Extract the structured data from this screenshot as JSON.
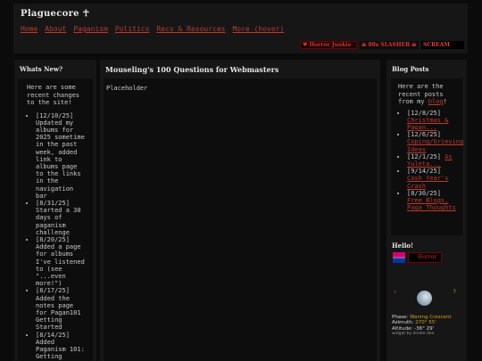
{
  "header": {
    "site_title": "Plaguecore ☥",
    "nav": [
      "Home",
      "About",
      "Paganism",
      "Politics",
      "Recs & Resources",
      "More (hover)"
    ],
    "badges": [
      "♥ Horror Junkie",
      "☠ 80s SLASHER ☠",
      "SCREAM"
    ]
  },
  "left": {
    "title": "Whats New?",
    "intro": "Here are some recent changes to the site!",
    "updates": [
      "[12/10/25] Updated my albums for 2025 sometime in the past week, added link to albums page to the links in the navigation bar",
      "[8/31/25] Started a 30 days of paganism challenge",
      "[8/20/25] Added a page for albums I've listened to (see \"...even more!\")",
      "[8/17/25] Added the notes page for Pagan101 Getting Started",
      "[8/14/25] Added Paganism 101: Getting"
    ]
  },
  "main": {
    "title": "Mouseling's 100 Questions for Webmasters",
    "content": "Placeholder"
  },
  "right": {
    "blog_title": "Blog Posts",
    "blog_intro_before": "Here are the recent posts from my ",
    "blog_link": "blog",
    "blog_intro_after": "!",
    "posts": [
      {
        "date": "[12/8/25]",
        "title": "Christmas & Pagan..."
      },
      {
        "date": "[12/6/25]",
        "title": "Coping/Grieving Ideas"
      },
      {
        "date": "[12/1/25]",
        "title": "As Yuleta..."
      },
      {
        "date": "[9/14/25]",
        "title": "Cash Year's Crash"
      },
      {
        "date": "[8/30/25]",
        "title": "Free Blogs, Paga Thoughts"
      }
    ],
    "hello_title": "Hello!",
    "horror_badge": "Horror",
    "moon": {
      "nav_prev": "‹",
      "nav_next": "?",
      "phase_label": "Phase:",
      "phase": "Waning Crescent",
      "azimuth_label": "Azimuth:",
      "azimuth": "270° 55'",
      "altitude_label": "Altitude:",
      "altitude": "-36° 29'",
      "credit": "widget by dinder.den"
    }
  }
}
